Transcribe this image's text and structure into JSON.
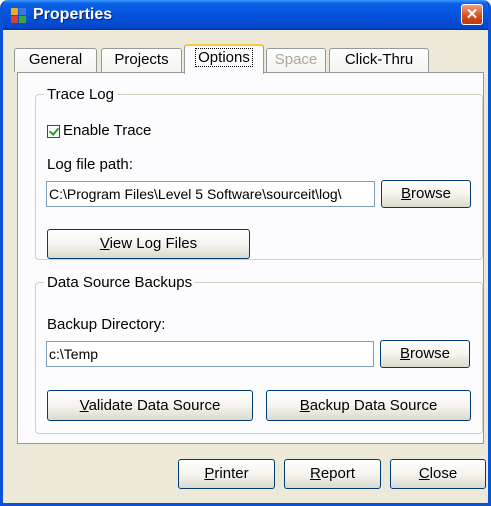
{
  "window": {
    "title": "Properties",
    "close_glyph": "✕"
  },
  "tabs": [
    {
      "label": "General",
      "state": "normal"
    },
    {
      "label": "Projects",
      "state": "normal"
    },
    {
      "label": "Options",
      "state": "active"
    },
    {
      "label": "Space",
      "state": "disabled"
    },
    {
      "label": "Click-Thru",
      "state": "normal"
    }
  ],
  "trace_log": {
    "legend": "Trace Log",
    "enable_trace": {
      "label": "Enable Trace",
      "checked": true
    },
    "log_path_label": "Log file path:",
    "log_path_value": "C:\\Program Files\\Level 5 Software\\sourceit\\log\\",
    "browse": {
      "mnemonic": "B",
      "rest": "rowse"
    },
    "view_logs": {
      "mnemonic": "V",
      "rest": "iew Log Files"
    }
  },
  "backups": {
    "legend": "Data Source Backups",
    "dir_label": "Backup Directory:",
    "dir_value": "c:\\Temp",
    "browse": {
      "mnemonic": "B",
      "rest": "rowse"
    },
    "validate": {
      "mnemonic": "V",
      "rest": "alidate Data Source"
    },
    "backup": {
      "mnemonic": "B",
      "rest": "ackup Data Source"
    }
  },
  "footer": {
    "printer": {
      "mnemonic": "P",
      "rest": "rinter"
    },
    "report": {
      "mnemonic": "R",
      "rest": "eport"
    },
    "close": {
      "mnemonic": "C",
      "rest": "lose"
    }
  },
  "colors": {
    "titlebar": "#0553dd",
    "face": "#ece9d8",
    "active_tab_accent": "#ffc83c"
  }
}
